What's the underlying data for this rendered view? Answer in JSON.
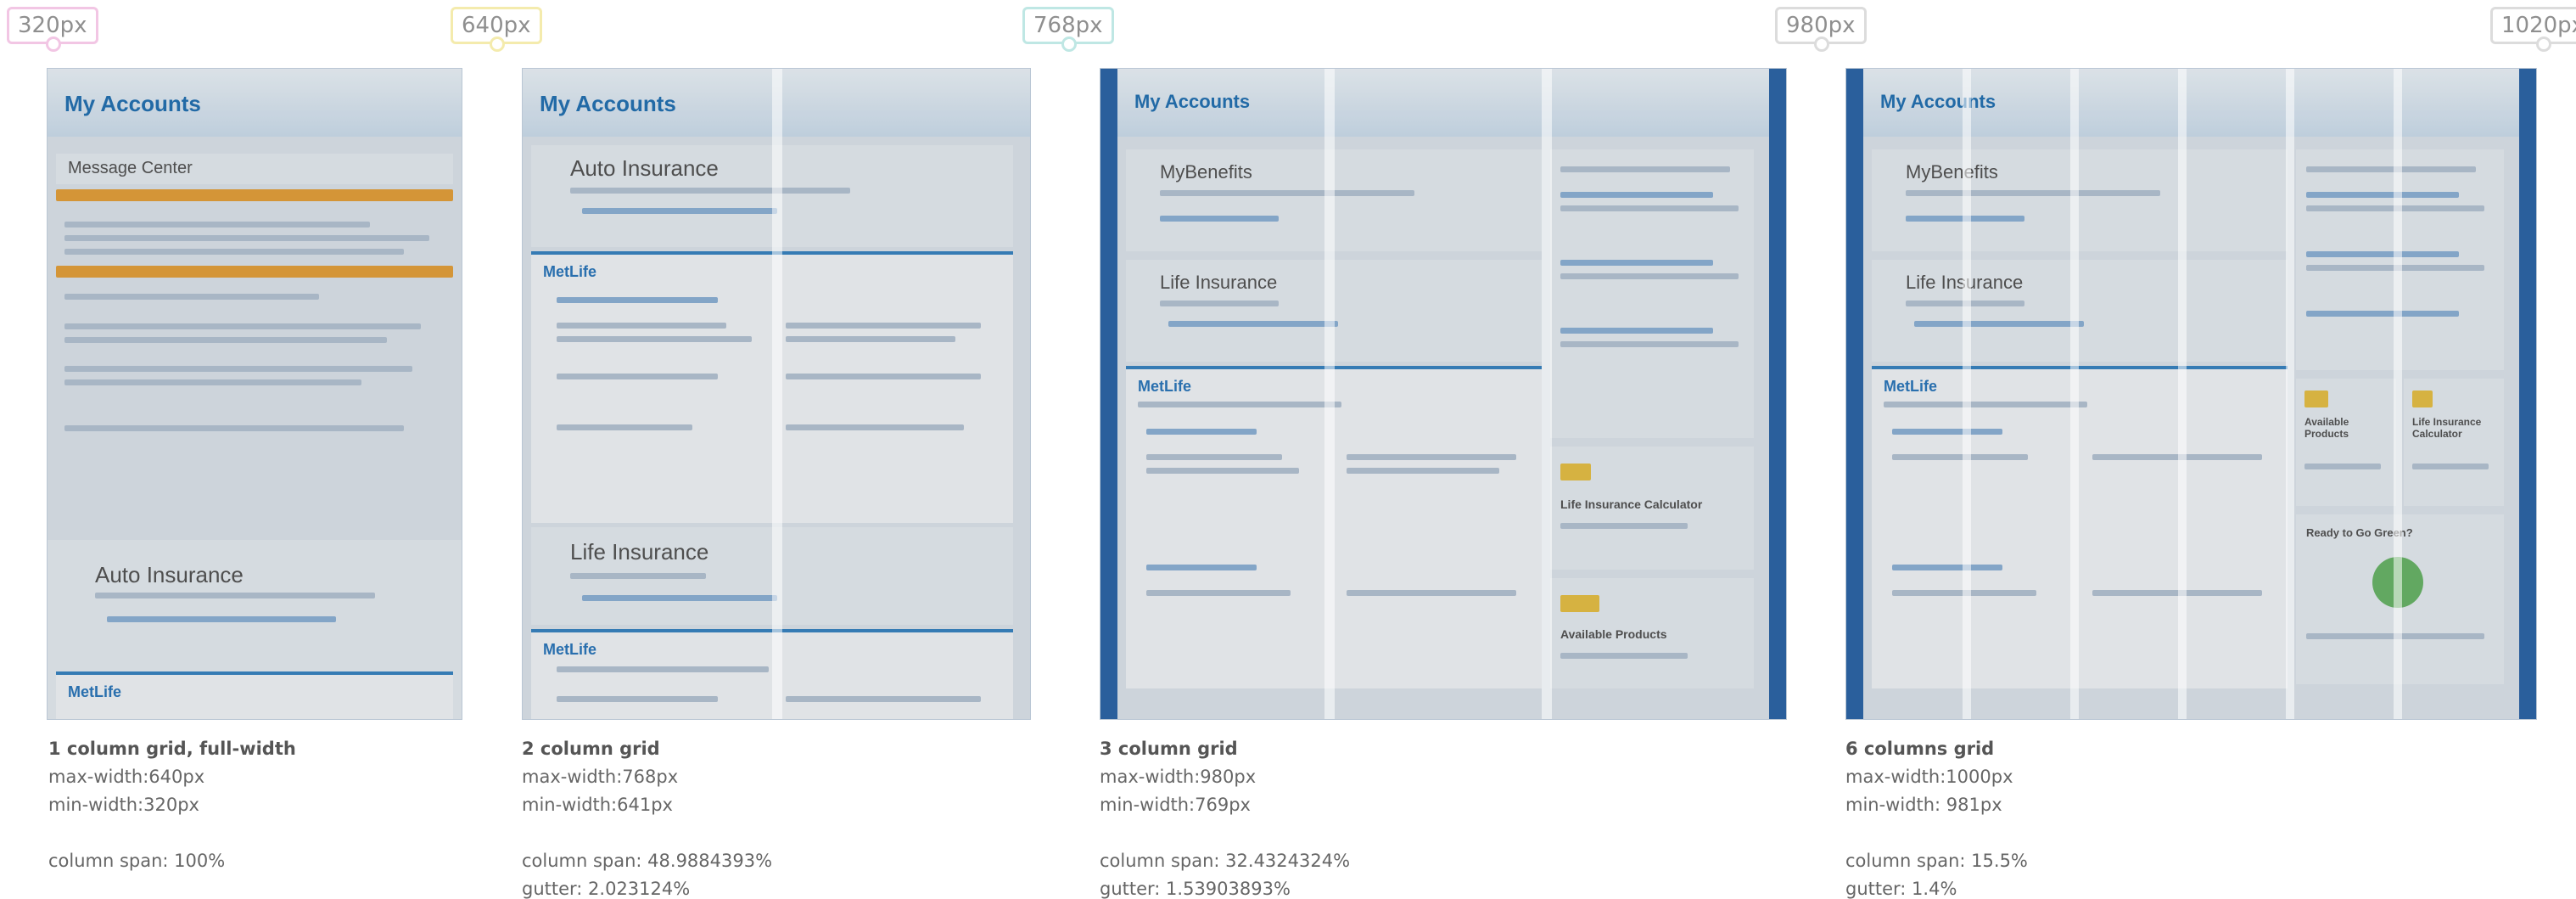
{
  "breakpoints": [
    "320px",
    "640px",
    "768px",
    "980px",
    "1020px"
  ],
  "screens": {
    "s1": {
      "page_title": "My Accounts",
      "section_a": "Message Center",
      "section_b": "Auto Insurance",
      "section_c": "MetLife"
    },
    "s2": {
      "page_title": "My Accounts",
      "section_a": "Auto Insurance",
      "section_b": "MetLife",
      "section_c": "Life Insurance",
      "section_d": "MetLife"
    },
    "s3": {
      "page_title": "My Accounts",
      "section_a": "MyBenefits",
      "section_b": "Life Insurance",
      "section_c": "MetLife",
      "side_a": "Life Insurance Calculator",
      "side_b": "Available Products"
    },
    "s4": {
      "page_title": "My Accounts",
      "section_a": "MyBenefits",
      "section_b": "Life Insurance",
      "section_c": "MetLife",
      "side_a": "Available Products",
      "side_b": "Life Insurance Calculator",
      "side_c": "Ready to Go Green?"
    }
  },
  "captions": [
    {
      "title": "1 column grid, full-width",
      "max": "max-width:640px",
      "min": "min-width:320px",
      "span": "column span: 100%",
      "gutter": ""
    },
    {
      "title": "2 column grid",
      "max": "max-width:768px",
      "min": "min-width:641px",
      "span": "column span: 48.9884393%",
      "gutter": "gutter: 2.023124%"
    },
    {
      "title": "3 column grid",
      "max": "max-width:980px",
      "min": "min-width:769px",
      "span": "column span: 32.4324324%",
      "gutter": "gutter: 1.53903893%"
    },
    {
      "title": "6 columns grid",
      "max": "max-width:1000px",
      "min": "min-width: 981px",
      "span": "column span: 15.5%",
      "gutter": "gutter: 1.4%"
    }
  ]
}
